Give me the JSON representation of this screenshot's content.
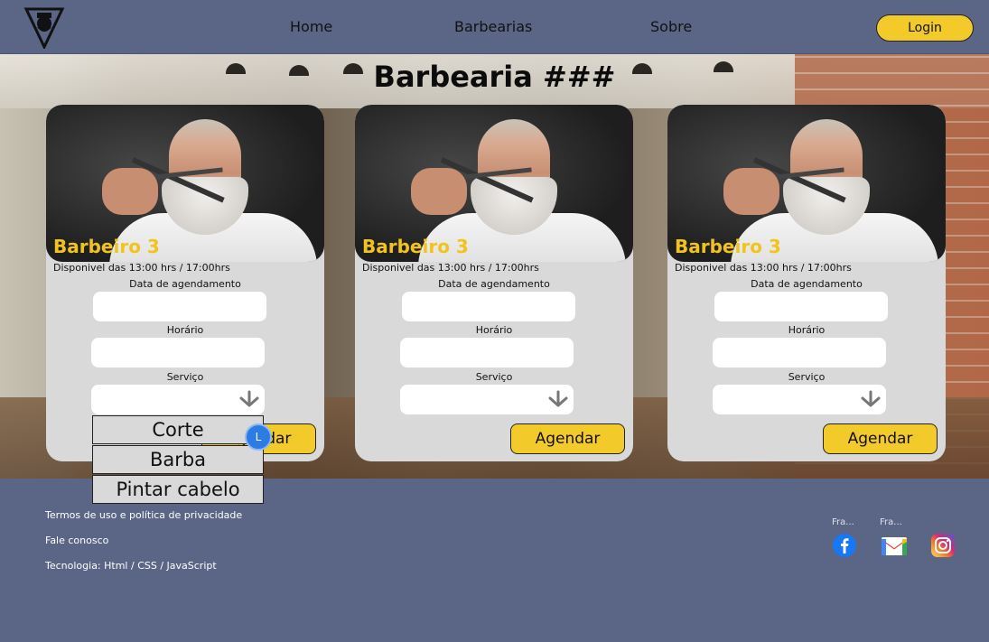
{
  "header": {
    "nav": [
      "Home",
      "Barbearias",
      "Sobre"
    ],
    "login_label": "Login"
  },
  "page_title": "Barbearia ###",
  "cards": [
    {
      "name": "Barbeiro 3",
      "availability": "Disponivel das 13:00 hrs / 17:00hrs",
      "date_label": "Data de agendamento",
      "time_label": "Horário",
      "service_label": "Serviço",
      "button_label": "Agendar"
    },
    {
      "name": "Barbeiro 3",
      "availability": "Disponivel das 13:00 hrs / 17:00hrs",
      "date_label": "Data de agendamento",
      "time_label": "Horário",
      "service_label": "Serviço",
      "button_label": "Agendar"
    },
    {
      "name": "Barbeiro 3",
      "availability": "Disponivel das 13:00 hrs / 17:00hrs",
      "date_label": "Data de agendamento",
      "time_label": "Horário",
      "service_label": "Serviço",
      "button_label": "Agendar"
    }
  ],
  "dropdown": {
    "options": [
      "Corte",
      "Barba",
      "Pintar cabelo"
    ]
  },
  "cursor_label": "L",
  "footer": {
    "links": [
      "Termos de uso e política de privacidade",
      "Fale conosco",
      "Tecnologia: Html / CSS / JavaScript"
    ],
    "social_captions": [
      "Fra...",
      "Fra..."
    ],
    "social_icons": [
      "facebook-icon",
      "gmail-icon",
      "instagram-icon"
    ]
  },
  "colors": {
    "header_bg": "#5b6686",
    "accent_yellow": "#f2cb2a",
    "card_bg": "#d9d9d9",
    "barber_name": "#f2c41b"
  }
}
